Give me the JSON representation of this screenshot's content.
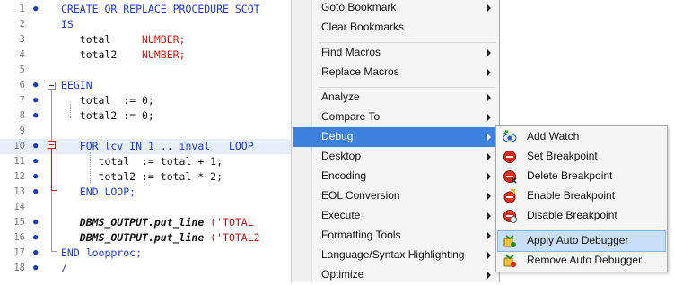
{
  "editor": {
    "lines": [
      {
        "num": "1",
        "bookmark": true,
        "tokens": [
          {
            "t": "CREATE OR REPLACE PROCEDURE SCOT",
            "c": "kw"
          }
        ]
      },
      {
        "num": "2",
        "bookmark": false,
        "tokens": [
          {
            "t": "IS",
            "c": "kw"
          }
        ]
      },
      {
        "num": "3",
        "bookmark": false,
        "tokens": [
          {
            "t": "   total     ",
            "c": "pl"
          },
          {
            "t": "NUMBER;",
            "c": "ty"
          }
        ]
      },
      {
        "num": "4",
        "bookmark": false,
        "tokens": [
          {
            "t": "   total2    ",
            "c": "pl"
          },
          {
            "t": "NUMBER;",
            "c": "ty"
          }
        ]
      },
      {
        "num": "5",
        "bookmark": false,
        "tokens": []
      },
      {
        "num": "6",
        "bookmark": true,
        "tokens": [
          {
            "t": "BEGIN",
            "c": "kw"
          }
        ]
      },
      {
        "num": "7",
        "bookmark": true,
        "tokens": [
          {
            "t": "   total  := 0;",
            "c": "pl"
          }
        ]
      },
      {
        "num": "8",
        "bookmark": true,
        "tokens": [
          {
            "t": "   total2 := 0;",
            "c": "pl"
          }
        ]
      },
      {
        "num": "9",
        "bookmark": false,
        "tokens": []
      },
      {
        "num": "10",
        "bookmark": true,
        "tokens": [
          {
            "t": "   FOR lcv IN 1 .. inval   LOOP",
            "c": "kw"
          }
        ]
      },
      {
        "num": "11",
        "bookmark": true,
        "tokens": [
          {
            "t": "      total  := total + 1;",
            "c": "pl"
          }
        ]
      },
      {
        "num": "12",
        "bookmark": true,
        "tokens": [
          {
            "t": "      total2 := total * 2;",
            "c": "pl"
          }
        ]
      },
      {
        "num": "13",
        "bookmark": true,
        "tokens": [
          {
            "t": "   END LOOP;",
            "c": "kw"
          }
        ]
      },
      {
        "num": "14",
        "bookmark": false,
        "tokens": []
      },
      {
        "num": "15",
        "bookmark": true,
        "tokens": [
          {
            "t": "   DBMS_OUTPUT.put_line",
            "c": "fn"
          },
          {
            "t": " ('TOTAL ",
            "c": "st"
          }
        ]
      },
      {
        "num": "16",
        "bookmark": true,
        "tokens": [
          {
            "t": "   DBMS_OUTPUT.put_line",
            "c": "fn"
          },
          {
            "t": " ('TOTAL2",
            "c": "st"
          }
        ]
      },
      {
        "num": "17",
        "bookmark": true,
        "tokens": [
          {
            "t": "END loopproc;",
            "c": "kw"
          }
        ]
      },
      {
        "num": "18",
        "bookmark": true,
        "tokens": [
          {
            "t": "/",
            "c": "kw"
          }
        ]
      }
    ],
    "current_line": "10"
  },
  "context_menu": {
    "items": [
      {
        "label": "Goto Bookmark",
        "submenu": true
      },
      {
        "label": "Clear Bookmarks",
        "submenu": false
      },
      {
        "sep": true
      },
      {
        "label": "Find Macros",
        "submenu": true
      },
      {
        "label": "Replace Macros",
        "submenu": true
      },
      {
        "sep": true
      },
      {
        "label": "Analyze",
        "submenu": true
      },
      {
        "label": "Compare To",
        "submenu": true
      },
      {
        "label": "Debug",
        "submenu": true,
        "highlighted": true
      },
      {
        "label": "Desktop",
        "submenu": true
      },
      {
        "label": "Encoding",
        "submenu": true
      },
      {
        "label": "EOL Conversion",
        "submenu": true
      },
      {
        "label": "Execute",
        "submenu": true
      },
      {
        "label": "Formatting Tools",
        "submenu": true
      },
      {
        "label": "Language/Syntax Highlighting",
        "submenu": true
      },
      {
        "label": "Optimize",
        "submenu": true
      }
    ]
  },
  "debug_submenu": {
    "items": [
      {
        "label": "Add Watch",
        "icon": "add-watch-icon"
      },
      {
        "label": "Set Breakpoint",
        "icon": "set-breakpoint-icon"
      },
      {
        "label": "Delete Breakpoint",
        "icon": "delete-breakpoint-icon"
      },
      {
        "label": "Enable Breakpoint",
        "icon": "enable-breakpoint-icon"
      },
      {
        "label": "Disable Breakpoint",
        "icon": "disable-breakpoint-icon"
      },
      {
        "sep": true
      },
      {
        "label": "Apply Auto Debugger",
        "icon": "apply-auto-debugger-icon",
        "highlighted": true
      },
      {
        "label": "Remove Auto Debugger",
        "icon": "remove-auto-debugger-icon"
      }
    ]
  },
  "colors": {
    "keyword": "#1f3bd0",
    "type": "#d01818",
    "menu_highlight": "#3d82de",
    "submenu_highlight": "#c9def7"
  }
}
